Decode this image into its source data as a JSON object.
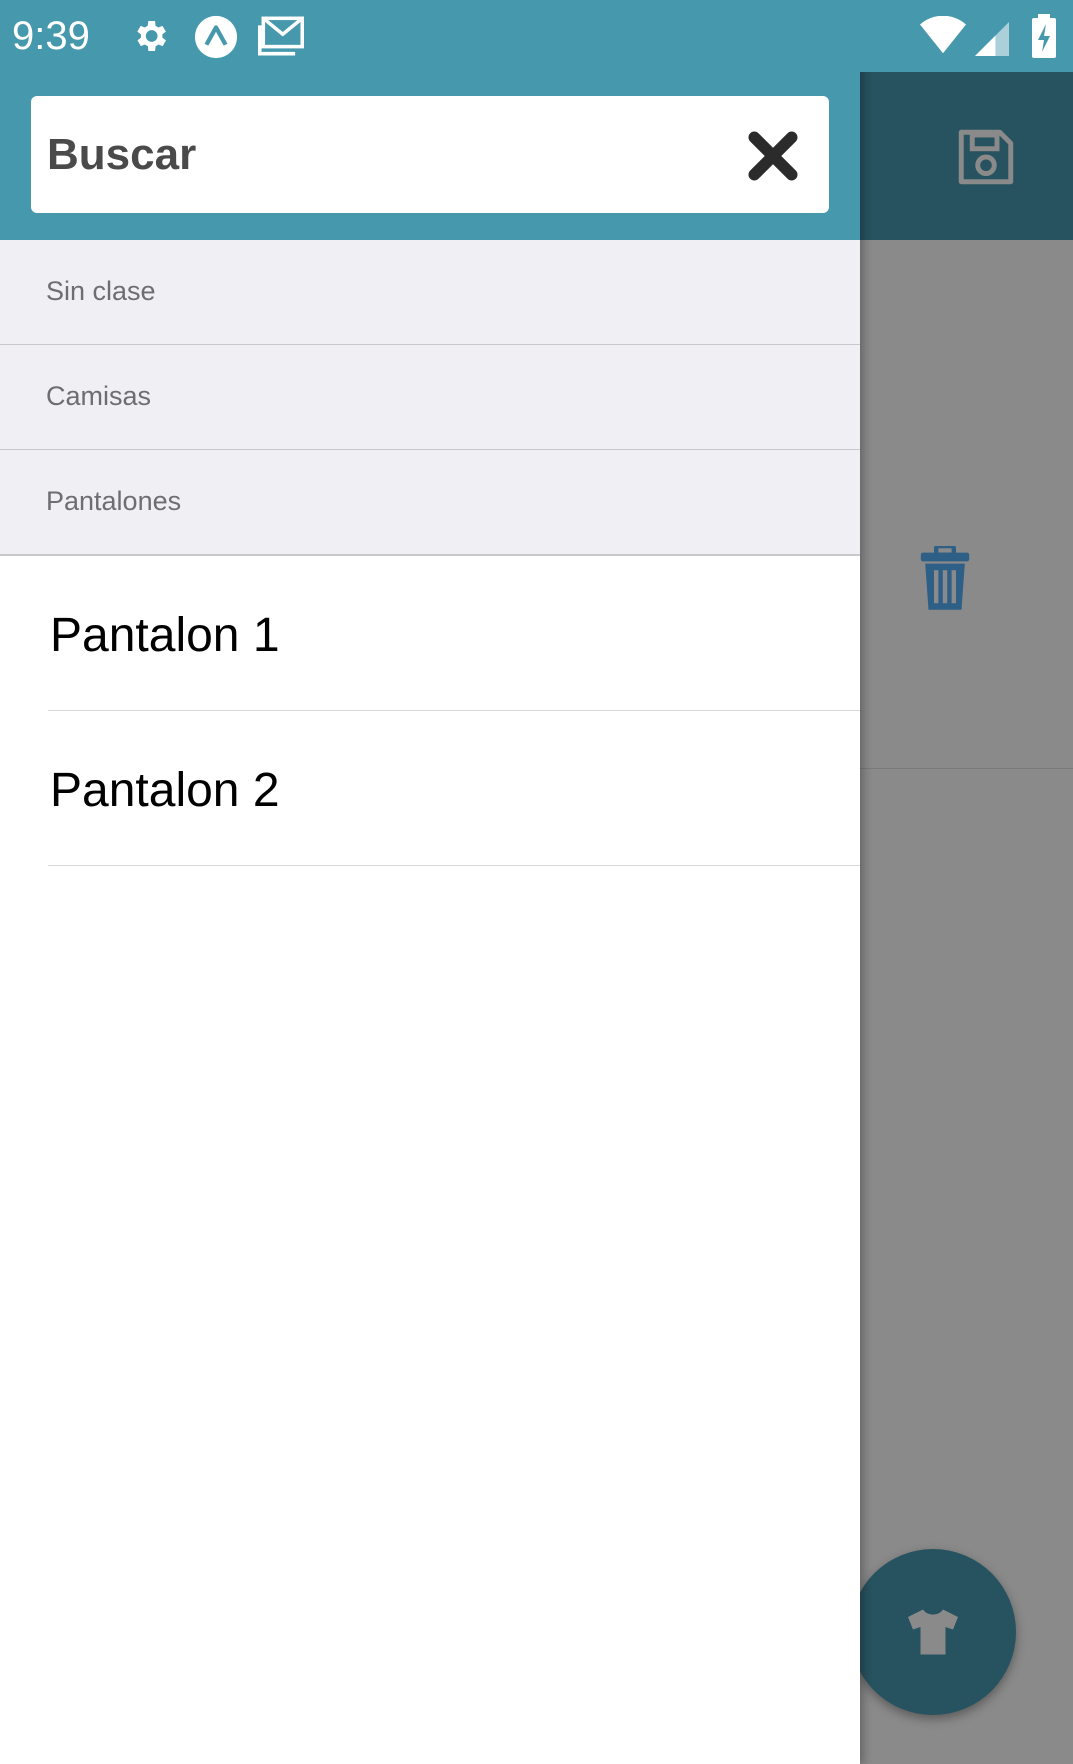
{
  "status_bar": {
    "time": "9:39",
    "left_icons": [
      "gear-icon",
      "expo-icon",
      "gmail-icon"
    ],
    "right_icons": [
      "wifi-icon",
      "signal-icon",
      "battery-charging-icon"
    ],
    "background": "#4698ad"
  },
  "drawer": {
    "search": {
      "placeholder": "Buscar",
      "value": ""
    },
    "sections": [
      {
        "label": "Sin clase"
      },
      {
        "label": "Camisas"
      },
      {
        "label": "Pantalones"
      }
    ],
    "items": [
      {
        "label": "Pantalon 1"
      },
      {
        "label": "Pantalon 2"
      }
    ]
  },
  "background_app": {
    "toolbar_color": "#27525f",
    "actions": [
      "save-icon",
      "trash-icon"
    ],
    "fab_icon": "shirt-icon",
    "accent": "#2a5f8a"
  }
}
